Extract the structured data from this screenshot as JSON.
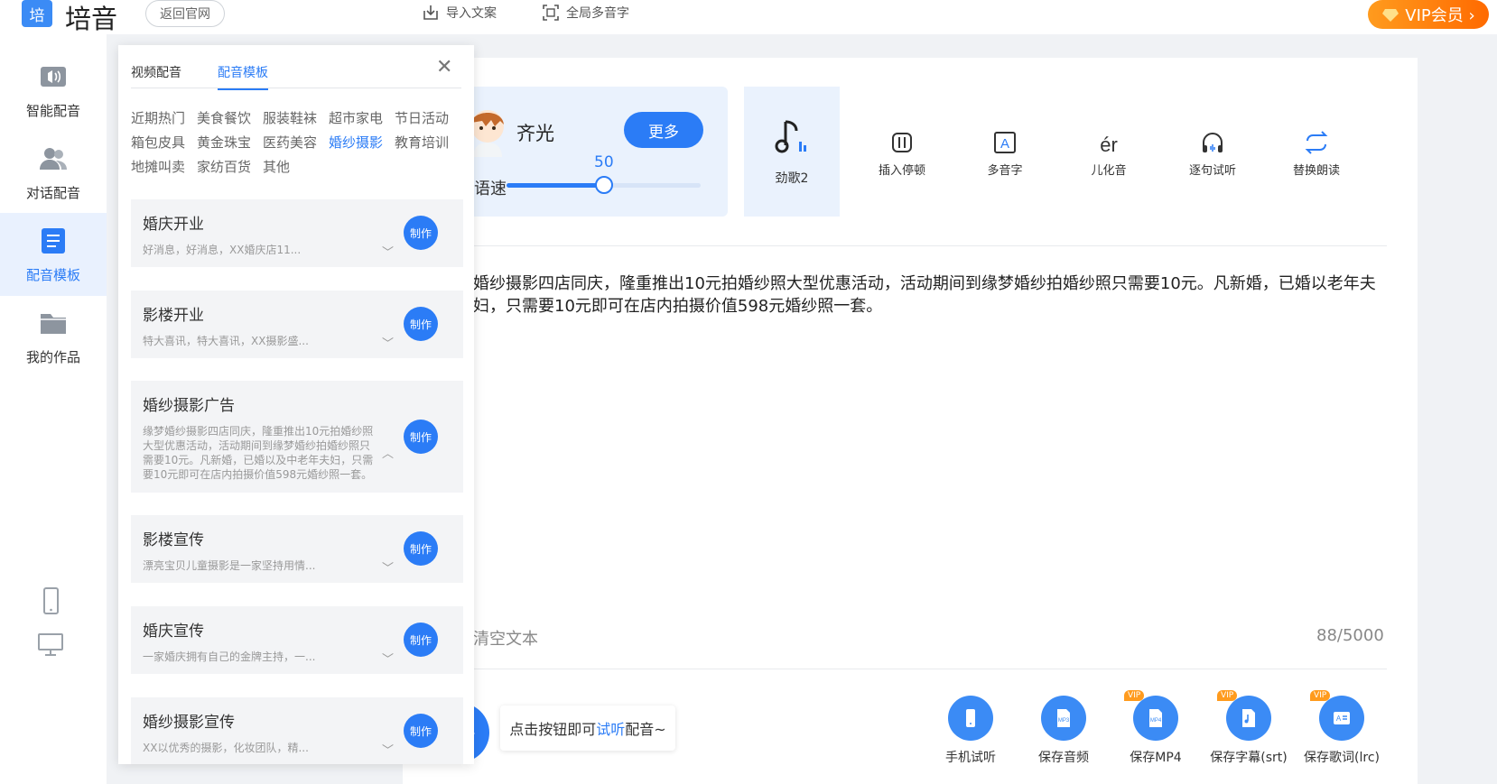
{
  "header": {
    "logo_glyph": "培",
    "app_name": "培音",
    "back_label": "返回官网",
    "import_label": "导入文案",
    "polyphone_label": "全局多音字",
    "vip_label": "VIP会员 ›",
    "accent_color": "#2b7cf6",
    "vip_color": "#ff8a00"
  },
  "nav": {
    "items": [
      {
        "label": "智能配音",
        "icon": "speaker-waves-icon"
      },
      {
        "label": "对话配音",
        "icon": "users-icon"
      },
      {
        "label": "配音模板",
        "icon": "document-icon"
      },
      {
        "label": "我的作品",
        "icon": "folder-icon"
      }
    ],
    "devices": [
      "phone-icon",
      "monitor-icon"
    ]
  },
  "panel": {
    "tabs": [
      "视频配音",
      "配音模板"
    ],
    "active_tab": "配音模板",
    "categories": [
      "近期热门",
      "美食餐饮",
      "服装鞋袜",
      "超市家电",
      "节日活动",
      "箱包皮具",
      "黄金珠宝",
      "医药美容",
      "婚纱摄影",
      "教育培训",
      "地摊叫卖",
      "家纺百货",
      "其他"
    ],
    "active_category": "婚纱摄影",
    "make_label": "制作",
    "templates": [
      {
        "title": "婚庆开业",
        "desc": "好消息，好消息，XX婚庆店11...",
        "expanded": false
      },
      {
        "title": "影楼开业",
        "desc": "特大喜讯，特大喜讯，XX摄影盛...",
        "expanded": false
      },
      {
        "title": "婚纱摄影广告",
        "desc": "缘梦婚纱摄影四店同庆，隆重推出10元拍婚纱照大型优惠活动，活动期间到缘梦婚纱拍婚纱照只需要10元。凡新婚，已婚以及中老年夫妇，只需要10元即可在店内拍摄价值598元婚纱照一套。",
        "expanded": true
      },
      {
        "title": "影楼宣传",
        "desc": "漂亮宝贝儿童摄影是一家坚持用情...",
        "expanded": false
      },
      {
        "title": "婚庆宣传",
        "desc": "一家婚庆拥有自己的金牌主持，一...",
        "expanded": false
      },
      {
        "title": "婚纱摄影宣传",
        "desc": "XX以优秀的摄影，化妆团队，精...",
        "expanded": false
      }
    ]
  },
  "voice": {
    "name": "齐光",
    "more_label": "更多",
    "speed_label": "语速",
    "speed_value": 50,
    "speed_fraction": 0.5
  },
  "music": {
    "label": "劲歌2"
  },
  "tools": [
    {
      "label": "插入停顿",
      "icon": "pause-icon"
    },
    {
      "label": "多音字",
      "icon": "polyphone-icon"
    },
    {
      "label": "儿化音",
      "icon": "erhua-icon"
    },
    {
      "label": "逐句试听",
      "icon": "headphones-icon"
    },
    {
      "label": "替换朗读",
      "icon": "replace-icon"
    }
  ],
  "editor": {
    "text": "婚纱摄影四店同庆，隆重推出10元拍婚纱照大型优惠活动，活动期间到缘梦婚纱拍婚纱照只需要10元。凡新婚，已婚以老年夫妇，只需要10元即可在店内拍摄价值598元婚纱照一套。",
    "clear_label": "清空文本",
    "char_count": "88/5000"
  },
  "bottom": {
    "hint_prefix": "点击按钮即可",
    "hint_link": "试听",
    "hint_suffix": "配音~",
    "vip_tag": "VIP",
    "actions": [
      {
        "label": "手机试听",
        "icon": "phone-icon",
        "vip": false
      },
      {
        "label": "保存音频",
        "icon": "mp3-file-icon",
        "vip": false
      },
      {
        "label": "保存MP4",
        "icon": "mp4-file-icon",
        "vip": true
      },
      {
        "label": "保存字幕(srt)",
        "icon": "subtitle-file-icon",
        "vip": true
      },
      {
        "label": "保存歌词(lrc)",
        "icon": "lyrics-file-icon",
        "vip": true
      }
    ]
  }
}
